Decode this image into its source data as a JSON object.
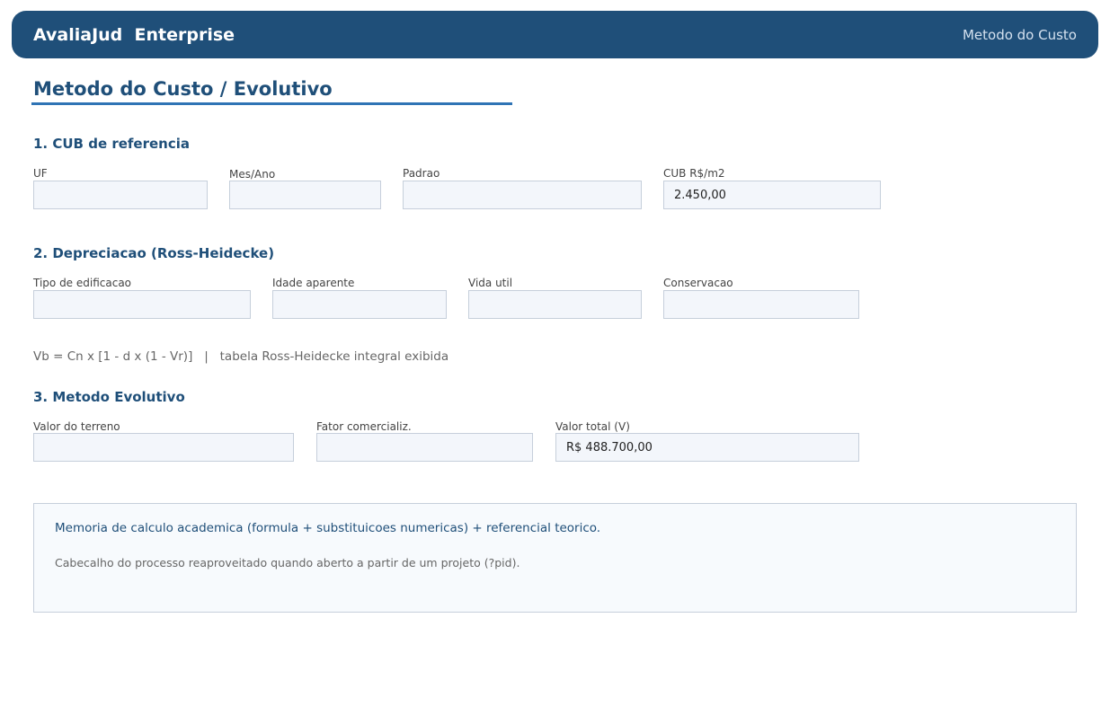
{
  "header": {
    "app_title": "AvaliaJud  Enterprise",
    "module_label": "Metodo do Custo"
  },
  "page": {
    "title": "Metodo do Custo / Evolutivo"
  },
  "cub_section": {
    "heading": "1. CUB de referencia",
    "fields": {
      "uf": {
        "label": "UF",
        "value": ""
      },
      "mes_ano": {
        "label": "Mes/Ano",
        "value": ""
      },
      "padrao": {
        "label": "Padrao",
        "value": ""
      },
      "cub_valor": {
        "label": "CUB R$/m2",
        "value": "2.450,00"
      }
    }
  },
  "depreciation_section": {
    "heading": "2. Depreciacao (Ross-Heidecke)",
    "fields": {
      "tipo_edificacao": {
        "label": "Tipo de edificacao",
        "value": ""
      },
      "idade_aparente": {
        "label": "Idade aparente",
        "value": ""
      },
      "vida_util": {
        "label": "Vida util",
        "value": ""
      },
      "conservacao": {
        "label": "Conservacao",
        "value": ""
      }
    },
    "formula_text": "Vb = Cn x [1 - d x (1 - Vr)]   |   tabela Ross-Heidecke integral exibida"
  },
  "evolutive_section": {
    "heading": "3. Metodo Evolutivo",
    "fields": {
      "valor_terreno": {
        "label": "Valor do terreno",
        "value": ""
      },
      "fator_comercializacao": {
        "label": "Fator comercializ.",
        "value": ""
      },
      "valor_total": {
        "label": "Valor total (V)",
        "value": "R$ 488.700,00"
      }
    }
  },
  "info_box": {
    "primary_text": "Memoria de calculo academica (formula + substituicoes numericas) + referencial teorico.",
    "secondary_text": "Cabecalho do processo reaproveitado quando aberto a partir de um projeto (?pid)."
  },
  "colors": {
    "header_bg": "#1f4f79",
    "accent_rule": "#2f74b5",
    "heading_text": "#1f4f79",
    "input_bg": "#f3f6fb",
    "input_border": "#c6cfdb"
  }
}
